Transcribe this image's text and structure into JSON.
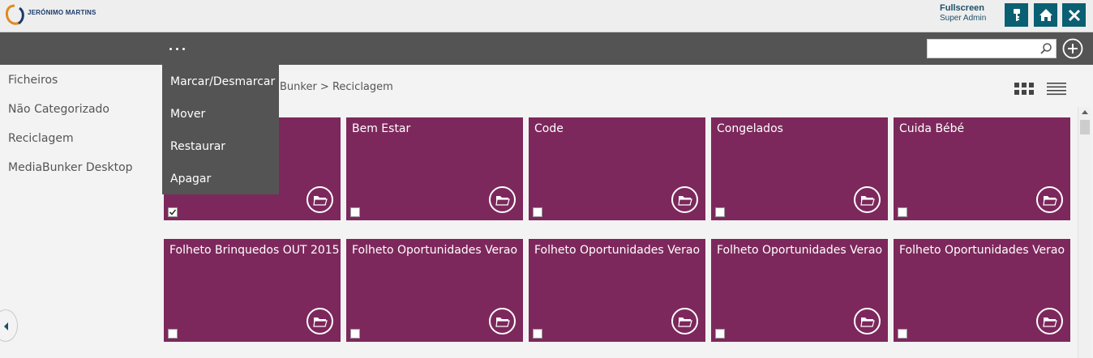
{
  "header": {
    "brand": "JERÓNIMO MARTINS",
    "user_name": "Fullscreen",
    "user_role": "Super Admin",
    "buttons": [
      {
        "icon": "key-icon"
      },
      {
        "icon": "home-icon"
      },
      {
        "icon": "close-icon"
      }
    ]
  },
  "toolbar": {
    "search_placeholder": ""
  },
  "menu": {
    "items": [
      "Marcar/Desmarcar",
      "Mover",
      "Restaurar",
      "Apagar"
    ]
  },
  "sidebar": {
    "items": [
      "Ficheiros",
      "Não Categorizado",
      "Reciclagem",
      "MediaBunker Desktop"
    ]
  },
  "breadcrumb": "Bunker  > Reciclagem",
  "tiles": [
    {
      "title": "",
      "checked": true
    },
    {
      "title": "Bem Estar",
      "checked": false
    },
    {
      "title": "Code",
      "checked": false
    },
    {
      "title": "Congelados",
      "checked": false
    },
    {
      "title": "Cuida Bébé",
      "checked": false
    },
    {
      "title": "Folheto Brinquedos OUT 2015",
      "checked": false
    },
    {
      "title": "Folheto Oportunidades Verao",
      "checked": false
    },
    {
      "title": "Folheto Oportunidades Verao",
      "checked": false
    },
    {
      "title": "Folheto Oportunidades Verao",
      "checked": false
    },
    {
      "title": "Folheto Oportunidades Verao",
      "checked": false
    }
  ],
  "colors": {
    "tile": "#7d285c",
    "toolbar": "#545454",
    "header_button": "#0b5f72"
  }
}
